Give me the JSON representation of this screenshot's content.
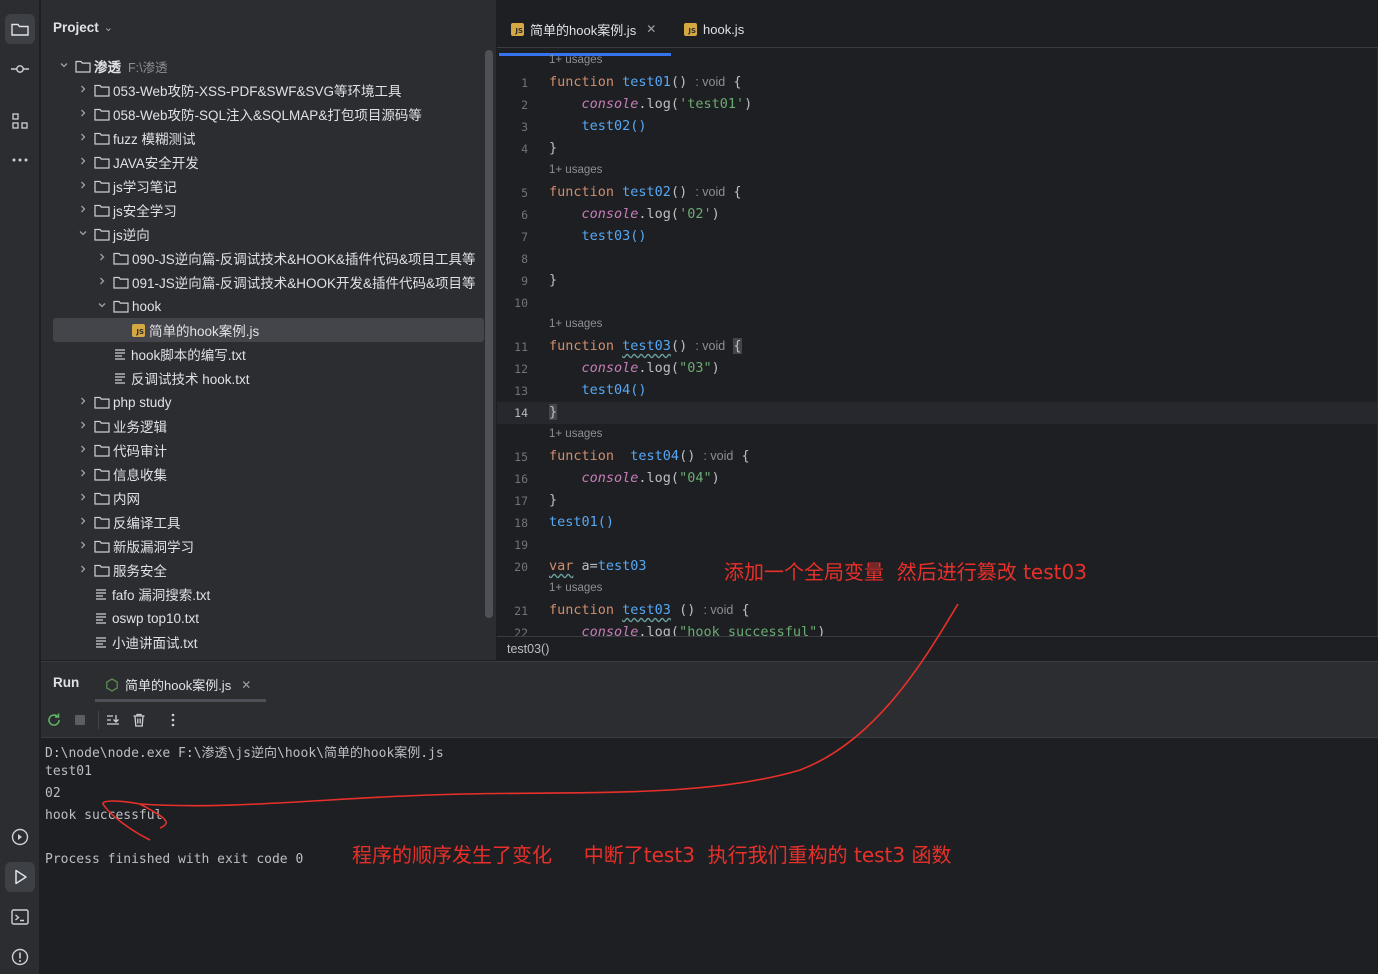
{
  "project": {
    "header": "Project",
    "rows": [
      {
        "label": "渗透",
        "note": "F:\\渗透",
        "kind": "folder",
        "depth": 0,
        "arrow": "down",
        "bold": true
      },
      {
        "label": "053-Web攻防-XSS-PDF&SWF&SVG等环境工具",
        "kind": "folder",
        "depth": 1,
        "arrow": "right"
      },
      {
        "label": "058-Web攻防-SQL注入&SQLMAP&打包项目源码等",
        "kind": "folder",
        "depth": 1,
        "arrow": "right"
      },
      {
        "label": "fuzz 模糊测试",
        "kind": "folder",
        "depth": 1,
        "arrow": "right"
      },
      {
        "label": "JAVA安全开发",
        "kind": "folder",
        "depth": 1,
        "arrow": "right"
      },
      {
        "label": "js学习笔记",
        "kind": "folder",
        "depth": 1,
        "arrow": "right"
      },
      {
        "label": "js安全学习",
        "kind": "folder",
        "depth": 1,
        "arrow": "right"
      },
      {
        "label": "js逆向",
        "kind": "folder",
        "depth": 1,
        "arrow": "down"
      },
      {
        "label": "090-JS逆向篇-反调试技术&HOOK&插件代码&项目工具等",
        "kind": "folder",
        "depth": 2,
        "arrow": "right"
      },
      {
        "label": "091-JS逆向篇-反调试技术&HOOK开发&插件代码&项目等",
        "kind": "folder",
        "depth": 2,
        "arrow": "right"
      },
      {
        "label": "hook",
        "kind": "folder",
        "depth": 2,
        "arrow": "down"
      },
      {
        "label": "简单的hook案例.js",
        "kind": "js",
        "depth": 3,
        "arrow": "",
        "selected": true
      },
      {
        "label": "hook脚本的编写.txt",
        "kind": "txt",
        "depth": 2,
        "arrow": ""
      },
      {
        "label": "反调试技术 hook.txt",
        "kind": "txt",
        "depth": 2,
        "arrow": ""
      },
      {
        "label": "php study",
        "kind": "folder",
        "depth": 1,
        "arrow": "right"
      },
      {
        "label": "业务逻辑",
        "kind": "folder",
        "depth": 1,
        "arrow": "right"
      },
      {
        "label": "代码审计",
        "kind": "folder",
        "depth": 1,
        "arrow": "right"
      },
      {
        "label": "信息收集",
        "kind": "folder",
        "depth": 1,
        "arrow": "right"
      },
      {
        "label": "内网",
        "kind": "folder",
        "depth": 1,
        "arrow": "right"
      },
      {
        "label": "反编译工具",
        "kind": "folder",
        "depth": 1,
        "arrow": "right"
      },
      {
        "label": "新版漏洞学习",
        "kind": "folder",
        "depth": 1,
        "arrow": "right"
      },
      {
        "label": "服务安全",
        "kind": "folder",
        "depth": 1,
        "arrow": "right"
      },
      {
        "label": "fafo 漏洞搜索.txt",
        "kind": "txt",
        "depth": 1,
        "arrow": ""
      },
      {
        "label": "oswp top10.txt",
        "kind": "txt",
        "depth": 1,
        "arrow": ""
      },
      {
        "label": "小迪讲面试.txt",
        "kind": "txt",
        "depth": 1,
        "arrow": ""
      }
    ]
  },
  "editor": {
    "tabs": [
      {
        "label": "简单的hook案例.js",
        "active": true
      },
      {
        "label": "hook.js",
        "active": false
      }
    ],
    "js_badge": "JS",
    "usage_hint": "1+ usages",
    "void_hint": ": void",
    "line_numbers": [
      "1",
      "2",
      "3",
      "4",
      "5",
      "6",
      "7",
      "8",
      "9",
      "10",
      "11",
      "12",
      "13",
      "14",
      "15",
      "16",
      "17",
      "18",
      "19",
      "20",
      "21",
      "22"
    ],
    "current_line": "14",
    "code": {
      "kw_function": "function",
      "kw_var": "var",
      "l1_fn": "test01",
      "l1_tail": "() ",
      "l1_brace": "{",
      "l2_obj": "console",
      "l2_mid": ".log(",
      "l2_str": "'test01'",
      "l2_end": ")",
      "l3": "test02()",
      "l4": "}",
      "l5_fn": "test02",
      "l6_str": "'02'",
      "l7": "test03()",
      "l9": "}",
      "l11_fn": "test03",
      "l12_str": "\"03\"",
      "l13": "test04()",
      "l14": "}",
      "l15_fn": "test04",
      "l16_str": "\"04\"",
      "l17": "}",
      "l18": "test01()",
      "l20_a": "a=",
      "l20_fn": "test03",
      "l21_fn": "test03",
      "l21_tail": " () ",
      "l22_str": "\"hook successful\""
    },
    "breadcrumb": "test03()"
  },
  "run": {
    "title": "Run",
    "tab_label": "简单的hook案例.js",
    "console": [
      "D:\\node\\node.exe F:\\渗透\\js逆向\\hook\\简单的hook案例.js",
      "test01",
      "02",
      "hook successful",
      "",
      "Process finished with exit code 0"
    ]
  },
  "annotations": {
    "top": "添加一个全局变量  然后进行篡改 test03",
    "bottom": "程序的顺序发生了变化     中断了test3  执行我们重构的 test3 函数",
    "color": "#e8302a"
  }
}
